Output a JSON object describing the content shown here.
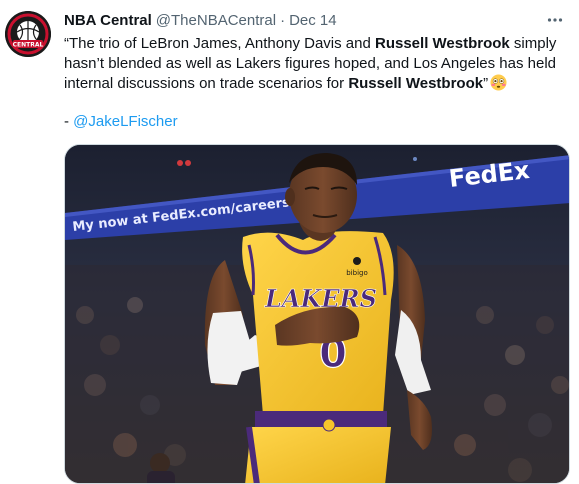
{
  "tweet": {
    "author_name": "NBA Central",
    "author_handle": "@TheNBACentral",
    "separator": "·",
    "date": "Dec 14",
    "more_icon": "more-horizontal-icon",
    "text": {
      "p1": "“The trio of LeBron James, Anthony Davis and ",
      "b1": "Russell Westbrook",
      "p2": " simply hasn’t blended as well as Lakers figures hoped, and Los Angeles has held internal discussions on trade scenarios for ",
      "b2": "Russell Westbrook",
      "p3": "”"
    },
    "emoji": "flushed-face-emoji",
    "credit_prefix": "- ",
    "credit_link": "@JakeLFischer"
  },
  "avatar": {
    "logo_text": "CENTRAL",
    "colors": {
      "ring": "#c8102e",
      "bg": "#1a1a1a"
    }
  },
  "media": {
    "banner_left": "My now at FedEx.com/careers",
    "banner_right": "FedEx",
    "jersey_team": "LAKERS",
    "jersey_number": "0",
    "jersey_sponsor": "bibigo",
    "colors": {
      "jersey_gold": "#f7c52b",
      "lakers_purple": "#4b2a7b",
      "banner_blue": "#2c3fa8",
      "arena_dark": "#1b1f2c"
    }
  },
  "colors": {
    "link": "#1d9bf0",
    "secondary_text": "#536471",
    "primary_text": "#0f1419"
  }
}
